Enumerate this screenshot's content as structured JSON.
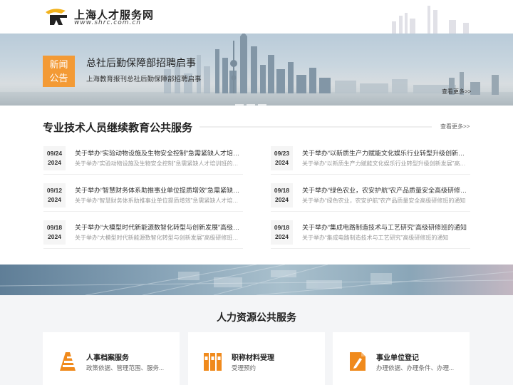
{
  "header": {
    "logo_title": "上海人才服务网",
    "logo_url": "www.shrc.com.cn"
  },
  "banner": {
    "badge_line1": "新闻",
    "badge_line2": "公告",
    "title": "总社后勤保障部招聘启事",
    "subtitle": "上海教育报刊总社后勤保障部招聘启事",
    "more": "查看更多>>"
  },
  "continuing_education": {
    "title": "专业技术人员继续教育公共服务",
    "more": "查看更多>>",
    "items": [
      {
        "date": "09/24",
        "year": "2024",
        "title": "关于举办“实验动物设施及生物安全控制”急需紧缺人才培训班的通知",
        "desc": "关于举办“实验动物设施及生物安全控制”急需紧缺人才培训班的通知"
      },
      {
        "date": "09/23",
        "year": "2024",
        "title": "关于举办“以新质生产力赋能文化娱乐行业转型升级创新发展”高级研修班的通知",
        "desc": "关于举办“以新质生产力赋能文化娱乐行业转型升级创新发展”高级研修班的通知"
      },
      {
        "date": "09/12",
        "year": "2024",
        "title": "关于举办“智慧财务体系助推事业单位提质增效”急需紧缺人才培训班的通知",
        "desc": "关于举办“智慧财务体系助推事业单位提质增效”急需紧缺人才培训班的通知"
      },
      {
        "date": "09/18",
        "year": "2024",
        "title": "关于举办“绿色农业，农安护航”农产品质量安全高级研修班的通知",
        "desc": "关于举办“绿色农业，农安护航”农产品质量安全高级研修班的通知"
      },
      {
        "date": "09/18",
        "year": "2024",
        "title": "关于举办“大模型时代新能源数智化转型与创新发展”高级研修班的通知",
        "desc": "关于举办“大模型时代新能源数智化转型与创新发展”高级研修班的通知"
      },
      {
        "date": "09/18",
        "year": "2024",
        "title": "关于举办“集成电路制造技术与工艺研究”高级研修班的通知",
        "desc": "关于举办“集成电路制造技术与工艺研究”高级研修班的通知"
      }
    ]
  },
  "hr_services": {
    "title": "人力资源公共服务",
    "cards": [
      {
        "title": "人事档案服务",
        "desc": "政策依据、管理范围、服务...",
        "icon": "archive-icon"
      },
      {
        "title": "职称材料受理",
        "desc": "受理预约",
        "icon": "binders-icon"
      },
      {
        "title": "事业单位登记",
        "desc": "办理依据、办理条件、办理...",
        "icon": "register-icon"
      }
    ]
  },
  "colors": {
    "accent": "#f39a35",
    "icon_orange": "#f08a1c"
  }
}
